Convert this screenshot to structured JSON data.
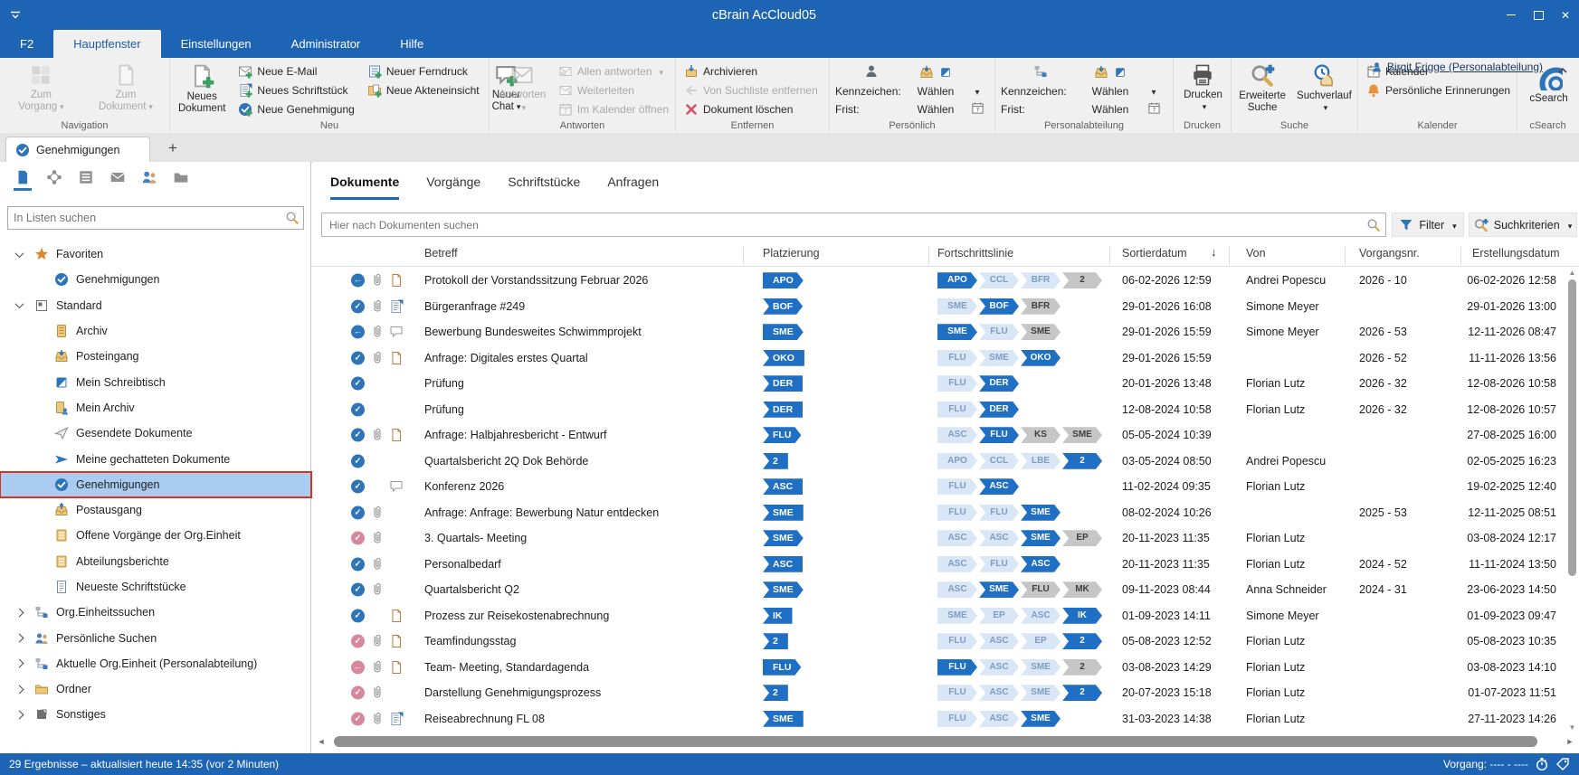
{
  "window": {
    "title": "cBrain AcCloud05"
  },
  "menu": {
    "items": [
      "F2",
      "Hauptfenster",
      "Einstellungen",
      "Administrator",
      "Hilfe"
    ],
    "active": "Hauptfenster",
    "user": "Birgit Frigge (Personalabteilung)"
  },
  "ribbon": {
    "navigation": {
      "label": "Navigation",
      "zum_vorgang": "Zum Vorgang",
      "zum_dokument": "Zum Dokument"
    },
    "neu": {
      "label": "Neu",
      "neues_dokument": "Neues Dokument",
      "neue_email": "Neue E-Mail",
      "neues_schriftstueck": "Neues Schriftstück",
      "neue_genehmigung": "Neue Genehmigung",
      "neuer_ferndruck": "Neuer Ferndruck",
      "neue_akteneinsicht": "Neue Akteneinsicht",
      "neuer_chat": "Neuer Chat"
    },
    "antworten": {
      "label": "Antworten",
      "antworten": "Antworten",
      "allen_antworten": "Allen antworten",
      "weiterleiten": "Weiterleiten",
      "im_kalender_oeffnen": "Im Kalender öffnen"
    },
    "entfernen": {
      "label": "Entfernen",
      "archivieren": "Archivieren",
      "von_suchliste_entfernen": "Von Suchliste entfernen",
      "dokument_loeschen": "Dokument löschen"
    },
    "persoenlich": {
      "label": "Persönlich",
      "kennzeichen": "Kennzeichen:",
      "frist": "Frist:",
      "waehlen_kennzeichen": "Wählen",
      "waehlen_frist": "Wählen"
    },
    "personalabteilung": {
      "label": "Personalabteilung",
      "kennzeichen": "Kennzeichen:",
      "frist": "Frist:",
      "waehlen_kennzeichen": "Wählen",
      "waehlen_frist": "Wählen"
    },
    "drucken": {
      "label": "Drucken",
      "drucken": "Drucken"
    },
    "suche": {
      "label": "Suche",
      "erweiterte_suche": "Erweiterte Suche",
      "suchverlauf": "Suchverlauf"
    },
    "kalender": {
      "label": "Kalender",
      "kalender": "Kalender",
      "persoenliche_erinnerungen": "Persönliche Erinnerungen"
    },
    "csearch": {
      "label": "cSearch",
      "csearch": "cSearch"
    }
  },
  "tabstrip": {
    "active_tab": "Genehmigungen"
  },
  "sidebar": {
    "search_placeholder": "In Listen suchen",
    "tree": [
      {
        "label": "Favoriten",
        "icon": "star",
        "level": 0,
        "expanded": "open"
      },
      {
        "label": "Genehmigungen",
        "icon": "approval",
        "level": 1
      },
      {
        "label": "Standard",
        "icon": "standard",
        "level": 0,
        "expanded": "open"
      },
      {
        "label": "Archiv",
        "icon": "archive",
        "level": 1
      },
      {
        "label": "Posteingang",
        "icon": "inbox",
        "level": 1
      },
      {
        "label": "Mein Schreibtisch",
        "icon": "note",
        "level": 1
      },
      {
        "label": "Mein Archiv",
        "icon": "myarchive",
        "level": 1
      },
      {
        "label": "Gesendete Dokumente",
        "icon": "plane",
        "level": 1
      },
      {
        "label": "Meine gechatteten Dokumente",
        "icon": "send",
        "level": 1
      },
      {
        "label": "Genehmigungen",
        "icon": "approval",
        "level": 1,
        "selected": true,
        "highlighted": true
      },
      {
        "label": "Postausgang",
        "icon": "outbox",
        "level": 1
      },
      {
        "label": "Offene Vorgänge der Org.Einheit",
        "icon": "caselist",
        "level": 1
      },
      {
        "label": "Abteilungsberichte",
        "icon": "caselist",
        "level": 1
      },
      {
        "label": "Neueste Schriftstücke",
        "icon": "record",
        "level": 1
      },
      {
        "label": "Org.Einheitssuchen",
        "icon": "org",
        "level": 0,
        "expanded": "closed"
      },
      {
        "label": "Persönliche Suchen",
        "icon": "people",
        "level": 0,
        "expanded": "closed"
      },
      {
        "label": "Aktuelle Org.Einheit (Personalabteilung)",
        "icon": "org",
        "level": 0,
        "expanded": "closed"
      },
      {
        "label": "Ordner",
        "icon": "folder",
        "level": 0,
        "expanded": "closed"
      },
      {
        "label": "Sonstiges",
        "icon": "misc",
        "level": 0,
        "expanded": "closed"
      }
    ]
  },
  "main": {
    "tabs": [
      "Dokumente",
      "Vorgänge",
      "Schriftstücke",
      "Anfragen"
    ],
    "active_tab": "Dokumente",
    "search_placeholder": "Hier nach Dokumenten suchen",
    "filter_label": "Filter",
    "suchkriterien_label": "Suchkriterien",
    "columns": [
      "Betreff",
      "Platzierung",
      "Fortschrittslinie",
      "Sortierdatum",
      "Von",
      "Vorgangsnr.",
      "Erstellungsdatum"
    ],
    "sort_column": "Sortierdatum",
    "rows": [
      {
        "status": "back-blue",
        "clip": true,
        "doc_icon": "page",
        "betreff": "Protokoll der Vorstandssitzung Februar 2026",
        "platzierung": {
          "label": "APO",
          "shape": "right"
        },
        "fortschritt": [
          {
            "label": "APO",
            "state": "blue"
          },
          {
            "label": "CCL",
            "state": "light"
          },
          {
            "label": "BFR",
            "state": "light"
          },
          {
            "label": "2",
            "state": "gray"
          }
        ],
        "sortierdatum": "06-02-2026 12:59",
        "von": "Andrei Popescu",
        "vorgangsnr": "2026 - 10",
        "erstellungsdatum": "06-02-2026 12:58"
      },
      {
        "status": "check-blue",
        "clip": true,
        "doc_icon": "doclines",
        "betreff": "Bürgeranfrage #249",
        "platzierung": {
          "label": "BOF",
          "shape": "both"
        },
        "fortschritt": [
          {
            "label": "SME",
            "state": "light"
          },
          {
            "label": "BOF",
            "state": "blue"
          },
          {
            "label": "BFR",
            "state": "gray"
          }
        ],
        "sortierdatum": "29-01-2026 16:08",
        "von": "Simone Meyer",
        "vorgangsnr": "",
        "erstellungsdatum": "29-01-2026 13:00"
      },
      {
        "status": "back-blue",
        "clip": true,
        "doc_icon": "bubble",
        "betreff": "Bewerbung Bundesweites Schwimmprojekt",
        "platzierung": {
          "label": "SME",
          "shape": "right"
        },
        "fortschritt": [
          {
            "label": "SME",
            "state": "blue"
          },
          {
            "label": "FLU",
            "state": "light"
          },
          {
            "label": "SME",
            "state": "gray"
          }
        ],
        "sortierdatum": "29-01-2026 15:59",
        "von": "Simone Meyer",
        "vorgangsnr": "2026 - 53",
        "erstellungsdatum": "12-11-2026 08:47"
      },
      {
        "status": "check-blue",
        "clip": true,
        "doc_icon": "page",
        "betreff": "Anfrage: Digitales erstes Quartal",
        "platzierung": {
          "label": "OKO",
          "shape": "left"
        },
        "fortschritt": [
          {
            "label": "FLU",
            "state": "light"
          },
          {
            "label": "SME",
            "state": "light"
          },
          {
            "label": "OKO",
            "state": "blue"
          }
        ],
        "sortierdatum": "29-01-2026 15:59",
        "von": "",
        "vorgangsnr": "2026 - 52",
        "erstellungsdatum": "11-11-2026 13:56"
      },
      {
        "status": "check-blue",
        "clip": false,
        "doc_icon": "",
        "betreff": "Prüfung",
        "platzierung": {
          "label": "DER",
          "shape": "left"
        },
        "fortschritt": [
          {
            "label": "FLU",
            "state": "light"
          },
          {
            "label": "DER",
            "state": "blue"
          }
        ],
        "sortierdatum": "20-01-2026 13:48",
        "von": "Florian Lutz",
        "vorgangsnr": "2026 - 32",
        "erstellungsdatum": "12-08-2026 10:58"
      },
      {
        "status": "check-blue",
        "clip": false,
        "doc_icon": "",
        "betreff": "Prüfung",
        "platzierung": {
          "label": "DER",
          "shape": "left"
        },
        "fortschritt": [
          {
            "label": "FLU",
            "state": "light"
          },
          {
            "label": "DER",
            "state": "blue"
          }
        ],
        "sortierdatum": "12-08-2024 10:58",
        "von": "Florian Lutz",
        "vorgangsnr": "2026 - 32",
        "erstellungsdatum": "12-08-2026 10:57"
      },
      {
        "status": "check-blue",
        "clip": true,
        "doc_icon": "page",
        "betreff": "Anfrage: Halbjahresbericht - Entwurf",
        "platzierung": {
          "label": "FLU",
          "shape": "both"
        },
        "fortschritt": [
          {
            "label": "ASC",
            "state": "light"
          },
          {
            "label": "FLU",
            "state": "blue"
          },
          {
            "label": "KS",
            "state": "gray"
          },
          {
            "label": "SME",
            "state": "gray"
          }
        ],
        "sortierdatum": "05-05-2024 10:39",
        "von": "",
        "vorgangsnr": "",
        "erstellungsdatum": "27-08-2025 16:00"
      },
      {
        "status": "check-blue",
        "clip": false,
        "doc_icon": "",
        "betreff": "Quartalsbericht 2Q Dok Behörde",
        "platzierung": {
          "label": "2",
          "shape": "left"
        },
        "fortschritt": [
          {
            "label": "APO",
            "state": "light"
          },
          {
            "label": "CCL",
            "state": "light"
          },
          {
            "label": "LBE",
            "state": "light"
          },
          {
            "label": "2",
            "state": "blue"
          }
        ],
        "sortierdatum": "03-05-2024 08:50",
        "von": "Andrei Popescu",
        "vorgangsnr": "",
        "erstellungsdatum": "02-05-2025 16:23"
      },
      {
        "status": "check-blue",
        "clip": false,
        "doc_icon": "bubble",
        "betreff": "Konferenz 2026",
        "platzierung": {
          "label": "ASC",
          "shape": "left"
        },
        "fortschritt": [
          {
            "label": "FLU",
            "state": "light"
          },
          {
            "label": "ASC",
            "state": "blue"
          }
        ],
        "sortierdatum": "11-02-2024 09:35",
        "von": "Florian Lutz",
        "vorgangsnr": "",
        "erstellungsdatum": "19-02-2025 12:40"
      },
      {
        "status": "check-blue",
        "clip": true,
        "doc_icon": "",
        "betreff": "Anfrage: Anfrage: Bewerbung Natur entdecken",
        "platzierung": {
          "label": "SME",
          "shape": "left"
        },
        "fortschritt": [
          {
            "label": "FLU",
            "state": "light"
          },
          {
            "label": "FLU",
            "state": "light"
          },
          {
            "label": "SME",
            "state": "blue"
          }
        ],
        "sortierdatum": "08-02-2024 10:26",
        "von": "",
        "vorgangsnr": "2025 - 53",
        "erstellungsdatum": "12-11-2025 08:51"
      },
      {
        "status": "check-pink",
        "clip": true,
        "doc_icon": "",
        "betreff": "3. Quartals- Meeting",
        "platzierung": {
          "label": "SME",
          "shape": "both"
        },
        "fortschritt": [
          {
            "label": "ASC",
            "state": "light"
          },
          {
            "label": "ASC",
            "state": "light"
          },
          {
            "label": "SME",
            "state": "blue"
          },
          {
            "label": "EP",
            "state": "gray"
          }
        ],
        "sortierdatum": "20-11-2023 11:35",
        "von": "Florian Lutz",
        "vorgangsnr": "",
        "erstellungsdatum": "03-08-2024 12:17"
      },
      {
        "status": "check-blue",
        "clip": true,
        "doc_icon": "",
        "betreff": "Personalbedarf",
        "platzierung": {
          "label": "ASC",
          "shape": "left"
        },
        "fortschritt": [
          {
            "label": "ASC",
            "state": "light"
          },
          {
            "label": "FLU",
            "state": "light"
          },
          {
            "label": "ASC",
            "state": "blue"
          }
        ],
        "sortierdatum": "20-11-2023 11:35",
        "von": "Florian Lutz",
        "vorgangsnr": "2024 - 52",
        "erstellungsdatum": "11-11-2024 13:50"
      },
      {
        "status": "check-blue",
        "clip": true,
        "doc_icon": "",
        "betreff": "Quartalsbericht Q2",
        "platzierung": {
          "label": "SME",
          "shape": "both"
        },
        "fortschritt": [
          {
            "label": "ASC",
            "state": "light"
          },
          {
            "label": "SME",
            "state": "blue"
          },
          {
            "label": "FLU",
            "state": "gray"
          },
          {
            "label": "MK",
            "state": "gray"
          }
        ],
        "sortierdatum": "09-11-2023 08:44",
        "von": "Anna Schneider",
        "vorgangsnr": "2024 - 31",
        "erstellungsdatum": "23-06-2023 14:50"
      },
      {
        "status": "check-blue",
        "clip": false,
        "doc_icon": "page",
        "betreff": "Prozess zur Reisekostenabrechnung",
        "platzierung": {
          "label": "IK",
          "shape": "left"
        },
        "fortschritt": [
          {
            "label": "SME",
            "state": "light"
          },
          {
            "label": "EP",
            "state": "light"
          },
          {
            "label": "ASC",
            "state": "light"
          },
          {
            "label": "IK",
            "state": "blue"
          }
        ],
        "sortierdatum": "01-09-2023 14:11",
        "von": "Simone Meyer",
        "vorgangsnr": "",
        "erstellungsdatum": "01-09-2023 09:47"
      },
      {
        "status": "check-pink",
        "clip": true,
        "doc_icon": "page",
        "betreff": "Teamfindungsstag",
        "platzierung": {
          "label": "2",
          "shape": "left"
        },
        "fortschritt": [
          {
            "label": "FLU",
            "state": "light"
          },
          {
            "label": "ASC",
            "state": "light"
          },
          {
            "label": "EP",
            "state": "light"
          },
          {
            "label": "2",
            "state": "blue"
          }
        ],
        "sortierdatum": "05-08-2023 12:52",
        "von": "Florian Lutz",
        "vorgangsnr": "",
        "erstellungsdatum": "05-08-2023 10:35"
      },
      {
        "status": "back-pink",
        "clip": true,
        "doc_icon": "page",
        "betreff": "Team- Meeting, Standardagenda",
        "platzierung": {
          "label": "FLU",
          "shape": "right"
        },
        "fortschritt": [
          {
            "label": "FLU",
            "state": "blue"
          },
          {
            "label": "ASC",
            "state": "light"
          },
          {
            "label": "SME",
            "state": "light"
          },
          {
            "label": "2",
            "state": "gray"
          }
        ],
        "sortierdatum": "03-08-2023 14:29",
        "von": "Florian Lutz",
        "vorgangsnr": "",
        "erstellungsdatum": "03-08-2023 14:10"
      },
      {
        "status": "check-pink",
        "clip": true,
        "doc_icon": "",
        "betreff": "Darstellung Genehmigungsprozess",
        "platzierung": {
          "label": "2",
          "shape": "left"
        },
        "fortschritt": [
          {
            "label": "FLU",
            "state": "light"
          },
          {
            "label": "ASC",
            "state": "light"
          },
          {
            "label": "SME",
            "state": "light"
          },
          {
            "label": "2",
            "state": "blue"
          }
        ],
        "sortierdatum": "20-07-2023 15:18",
        "von": "Florian Lutz",
        "vorgangsnr": "",
        "erstellungsdatum": "01-07-2023 11:51"
      },
      {
        "status": "check-pink",
        "clip": true,
        "doc_icon": "doclines",
        "betreff": "Reiseabrechnung FL 08",
        "platzierung": {
          "label": "SME",
          "shape": "left"
        },
        "fortschritt": [
          {
            "label": "FLU",
            "state": "light"
          },
          {
            "label": "ASC",
            "state": "light"
          },
          {
            "label": "SME",
            "state": "blue"
          }
        ],
        "sortierdatum": "31-03-2023 14:38",
        "von": "Florian Lutz",
        "vorgangsnr": "",
        "erstellungsdatum": "27-11-2023 14:26"
      }
    ]
  },
  "statusbar": {
    "left": "29 Ergebnisse – aktualisiert heute 14:35 (vor 2 Minuten)",
    "right": "Vorgang: ---- - ----"
  },
  "colors": {
    "brand_blue": "#1d64b4",
    "accent_blue": "#1f6fc5",
    "selected_row": "#a9ccf0",
    "highlight_red": "#d8321f",
    "badge_light": "#d9e6f6",
    "badge_gray": "#c6c6c6"
  }
}
